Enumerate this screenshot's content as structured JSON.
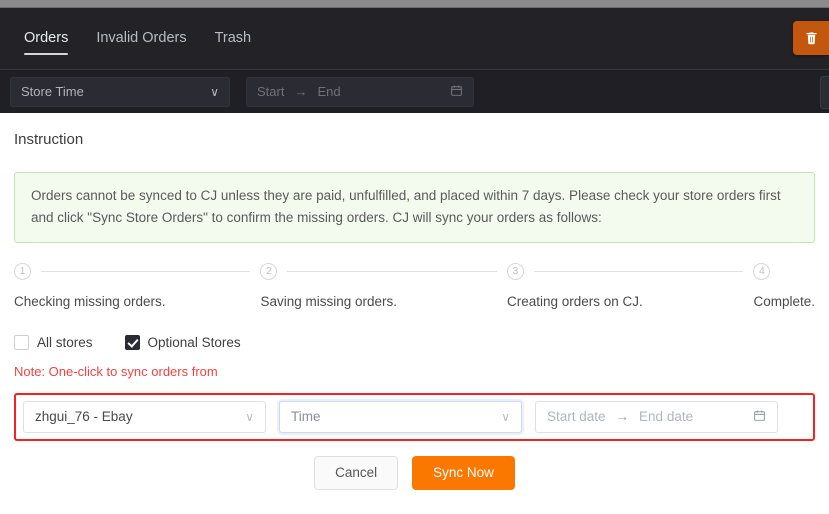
{
  "header": {
    "tabs": [
      {
        "label": "Orders",
        "active": true
      },
      {
        "label": "Invalid Orders",
        "active": false
      },
      {
        "label": "Trash",
        "active": false
      }
    ],
    "trash_button": {
      "icon": "trash-icon",
      "color": "#c4570f"
    }
  },
  "toolbar": {
    "store_time_select": {
      "value": "Store Time",
      "caret": "∨"
    },
    "date_range": {
      "start_placeholder": "Start",
      "end_placeholder": "End",
      "separator": "→",
      "calendar_icon": "calendar-icon"
    }
  },
  "panel": {
    "title": "Instruction",
    "notice": "Orders cannot be synced to CJ unless they are paid, unfulfilled, and placed within 7 days. Please check your store orders first and click \"Sync Store Orders\" to confirm the missing orders. CJ will sync your orders as follows:",
    "steps": [
      {
        "num": "1",
        "label": "Checking missing orders."
      },
      {
        "num": "2",
        "label": "Saving missing orders."
      },
      {
        "num": "3",
        "label": "Creating orders on CJ."
      },
      {
        "num": "4",
        "label": "Complete."
      }
    ],
    "checkboxes": [
      {
        "label": "All stores",
        "checked": false
      },
      {
        "label": "Optional Stores",
        "checked": true
      }
    ],
    "note": "Note: One-click to sync orders from",
    "form": {
      "store_select": {
        "value": "zhgui_76 - Ebay",
        "caret": "∨"
      },
      "time_select": {
        "value": "Time",
        "caret": "∨"
      },
      "date_range": {
        "start_placeholder": "Start date",
        "end_placeholder": "End date",
        "separator": "→",
        "calendar_icon": "calendar-icon"
      }
    },
    "footer": {
      "cancel_label": "Cancel",
      "sync_label": "Sync Now"
    }
  },
  "colors": {
    "accent_orange": "#fb7800",
    "trash_orange": "#c4570f",
    "highlight_red": "#f42222",
    "notice_bg": "#f2fbee",
    "notice_border": "#c2e7b0",
    "note_red": "#ef4444",
    "dark_header": "#222227",
    "dark_toolbar": "#1f1f25"
  }
}
